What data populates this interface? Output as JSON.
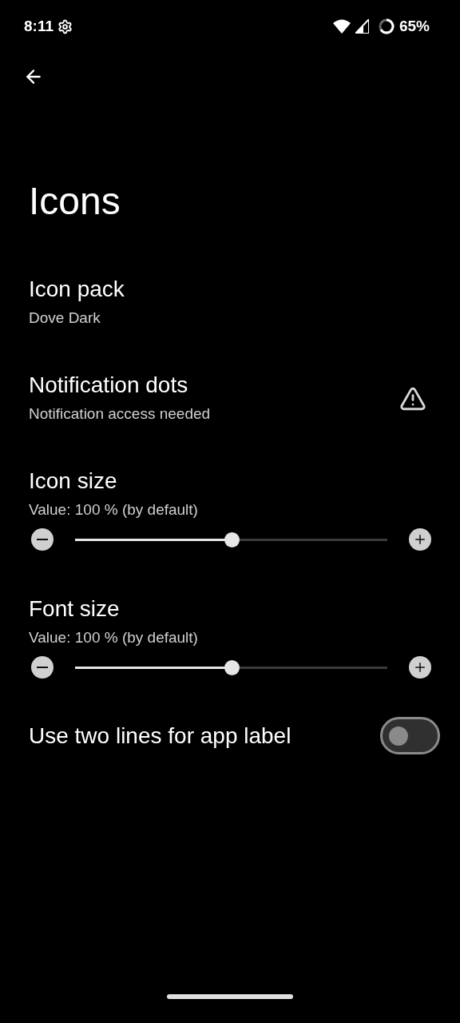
{
  "status_bar": {
    "time": "8:11",
    "battery": "65%"
  },
  "title": "Icons",
  "items": [
    {
      "kind": "text",
      "title": "Icon pack",
      "subtitle": "Dove Dark"
    },
    {
      "kind": "warning",
      "title": "Notification dots",
      "subtitle": "Notification access needed"
    },
    {
      "kind": "slider",
      "title": "Icon size",
      "subtitle": "Value: 100 % (by default)",
      "level": 0.5
    },
    {
      "kind": "slider",
      "title": "Font size",
      "subtitle": "Value: 100 % (by default)",
      "level": 0.5
    },
    {
      "kind": "switch",
      "title": "Use two lines for app label",
      "on": false
    }
  ]
}
